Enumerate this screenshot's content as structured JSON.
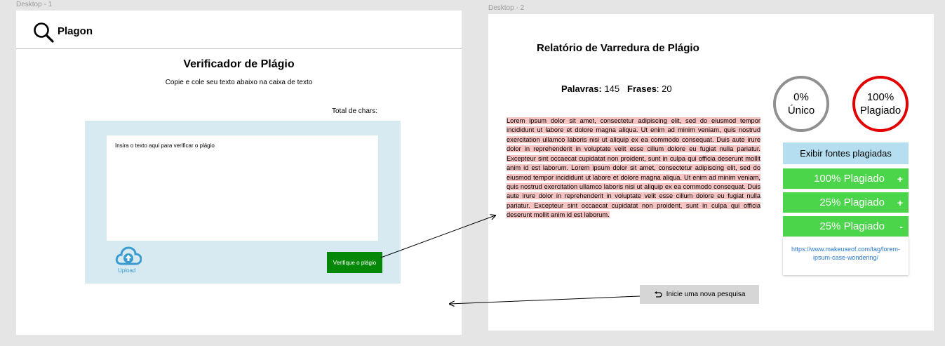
{
  "frames": {
    "desktop1_label": "Desktop - 1",
    "desktop2_label": "Desktop - 2"
  },
  "checker": {
    "logo_text": "Plagon",
    "title": "Verificador de Plágio",
    "subtitle": "Copie e cole seu texto abaixo na caixa de texto",
    "total_chars_label": "Total de chars:",
    "textarea_placeholder": "Insira o texto aqui para verificar o plágio",
    "upload_label": "Upload",
    "verify_button": "Verifique o plágio"
  },
  "report": {
    "title": "Relatório de Varredura de Plágio",
    "words_label": "Palavras:",
    "words_value": "145",
    "sentences_label": "Frases",
    "sentences_value": ": 20",
    "body_text": " Lorem ipsum dolor sit amet, consectetur adipiscing elit, sed do eiusmod tempor incididunt ut labore et dolore magna aliqua.  Ut enim ad minim veniam, quis nostrud exercitation ullamco laboris nisi ut aliquip ex ea commodo consequat.  Duis aute irure dolor in reprehenderit in voluptate velit esse cillum dolore eu fugiat nulla pariatur.  Excepteur sint occaecat cupidatat non proident, sunt in culpa qui officia deserunt mollit anim id est laborum.  Lorem ipsum dolor sit amet, consectetur adipiscing elit, sed do eiusmod tempor incididunt ut labore et dolore magna aliqua. Ut enim ad minim veniam, quis nostrud exercitation ullamco laboris nisi ut aliquip ex ea commodo consequat. Duis aute irure dolor in reprehenderit in voluptate velit esse cillum dolore eu fugiat nulla pariatur. Excepteur sint occaecat cupidatat non proident, sunt in culpa qui officia deserunt mollit anim id est laborum.",
    "unique_pct": "0%",
    "unique_label": "Único",
    "plag_pct": "100%",
    "plag_label": "Plagiado",
    "sources_button": "Exibir fontes plagiadas",
    "sources": [
      {
        "label": "100% Plagiado",
        "sign": "+"
      },
      {
        "label": "25% Plagiado",
        "sign": "+"
      },
      {
        "label": "25% Plagiado",
        "sign": "-"
      }
    ],
    "source_url": "https://www.makeuseof.com/tag/lorem-ipsum-case-wondering/",
    "new_search_button": "Inicie uma nova pesquisa"
  },
  "colors": {
    "verify_green": "#058808",
    "source_green": "#4bd54b",
    "unique_ring": "#909090",
    "plag_ring": "#e30000",
    "highlight": "#f6c3c3",
    "panel_blue": "#d7eaf1"
  },
  "icons": {
    "logo": "search-icon",
    "upload": "cloud-upload-icon",
    "new_search": "undo-icon"
  }
}
